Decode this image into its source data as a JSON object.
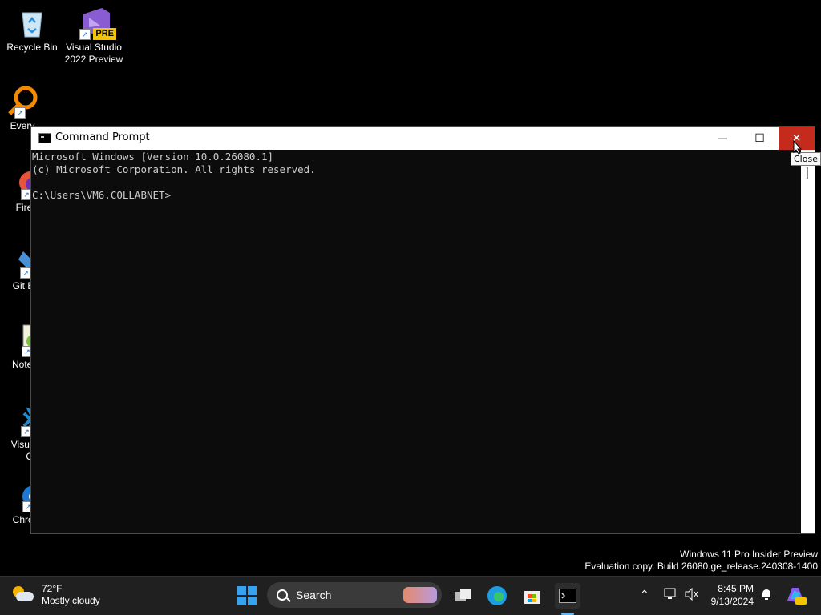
{
  "desktop": {
    "icons": [
      {
        "label_1": "Recycle Bin",
        "label_2": ""
      },
      {
        "label_1": "Visual Studio",
        "label_2": "2022 Preview",
        "badge": "PRE"
      },
      {
        "label_1": "Every",
        "label_2": ""
      },
      {
        "label_1": "Fire",
        "label_2": ""
      },
      {
        "label_1": "Git B",
        "label_2": ""
      },
      {
        "label_1": "Notep",
        "label_2": ""
      },
      {
        "label_1": "Visual",
        "label_2": "Co"
      },
      {
        "label_1": "Chron",
        "label_2": ""
      }
    ]
  },
  "cmd": {
    "title": "Command Prompt",
    "lines": [
      "Microsoft Windows [Version 10.0.26080.1]",
      "(c) Microsoft Corporation. All rights reserved.",
      "",
      "C:\\Users\\VM6.COLLABNET>"
    ],
    "minimize_glyph": "—",
    "maximize_glyph": "☐",
    "close_glyph": "✕",
    "tooltip": "Close"
  },
  "watermark": {
    "line1": "Windows 11 Pro Insider Preview",
    "line2": "Evaluation copy. Build 26080.ge_release.240308-1400"
  },
  "taskbar": {
    "weather_temp": "72°F",
    "weather_desc": "Mostly cloudy",
    "search_label": "Search",
    "time": "8:45 PM",
    "date": "9/13/2024"
  },
  "colors": {
    "close_red": "#c42b1c",
    "console_bg": "#0c0c0c",
    "taskbar_bg": "#202020",
    "accent_blue": "#37a2f0"
  }
}
